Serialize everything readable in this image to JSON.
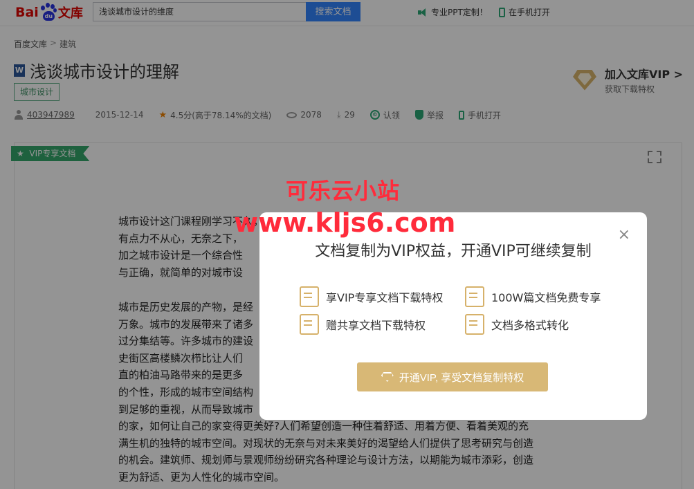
{
  "header": {
    "logo_bai": "Bai",
    "logo_du": "du",
    "logo_wenku": "文库",
    "search_value": "浅谈城市设计的维度",
    "search_button": "搜索文档",
    "link_ppt": "专业PPT定制！",
    "link_mobile": "在手机打开"
  },
  "breadcrumb": {
    "home": "百度文库",
    "sep": ">",
    "current": "建筑"
  },
  "doc": {
    "file_type": "W",
    "title": "浅谈城市设计的理解",
    "tag": "城市设计",
    "author": "403947989",
    "date": "2015-12-14",
    "rating": "4.5分(高于78.14%的文档)",
    "views": "2078",
    "downloads": "29",
    "claim": "认领",
    "report": "举报",
    "mobile_open": "手机打开"
  },
  "vip_join": {
    "title": "加入文库VIP",
    "arrow": ">",
    "subtitle": "获取下载特权"
  },
  "vip_ribbon": "VIP专享文档",
  "doc_text": {
    "p1": [
      "城市设计这门课程刚学习不久，",
      "有点力不从心，无奈之下，",
      "加之城市设计是一个综合性",
      "与正确，就简单的对城市设"
    ],
    "p2": [
      "城市是历史发展的产物，是经",
      "万象。城市的发展带来了诸多",
      "过分集结等。许多城市的建设",
      "史街区高楼鳞次栉比让人们",
      "直的柏油马路带来的是更多",
      "的个性，形成的城市空间结构",
      "到足够的重视，从而导致城市",
      "的家，如何让自己的家变得更美好?人们希望创造一种住着舒适、用着方便、看着美观的充",
      "满生机的独特的城市空间。对现状的无奈与对未来美好的渴望给人们提供了思考研究与创造",
      "的机会。建筑师、规划师与景观师纷纷研究各种理论与设计方法，以期能为城市添彩，创造",
      "更为舒适、更为人性化的城市空间。"
    ]
  },
  "modal": {
    "close": "×",
    "title": "文档复制为VIP权益，开通VIP可继续复制",
    "perks": [
      "享VIP专享文档下载特权",
      "100W篇文档免费专享",
      "赠共享文档下载特权",
      "文档多格式转化"
    ],
    "cta": "开通VIP, 享受文档复制特权"
  },
  "watermark": {
    "line1": "可乐云小站",
    "line2": "www.kljs6.com"
  },
  "colors": {
    "accent_green": "#2ba775",
    "vip_gold": "#d8b876",
    "search_blue": "#3385ff",
    "watermark_red": "#ff2b3b"
  }
}
